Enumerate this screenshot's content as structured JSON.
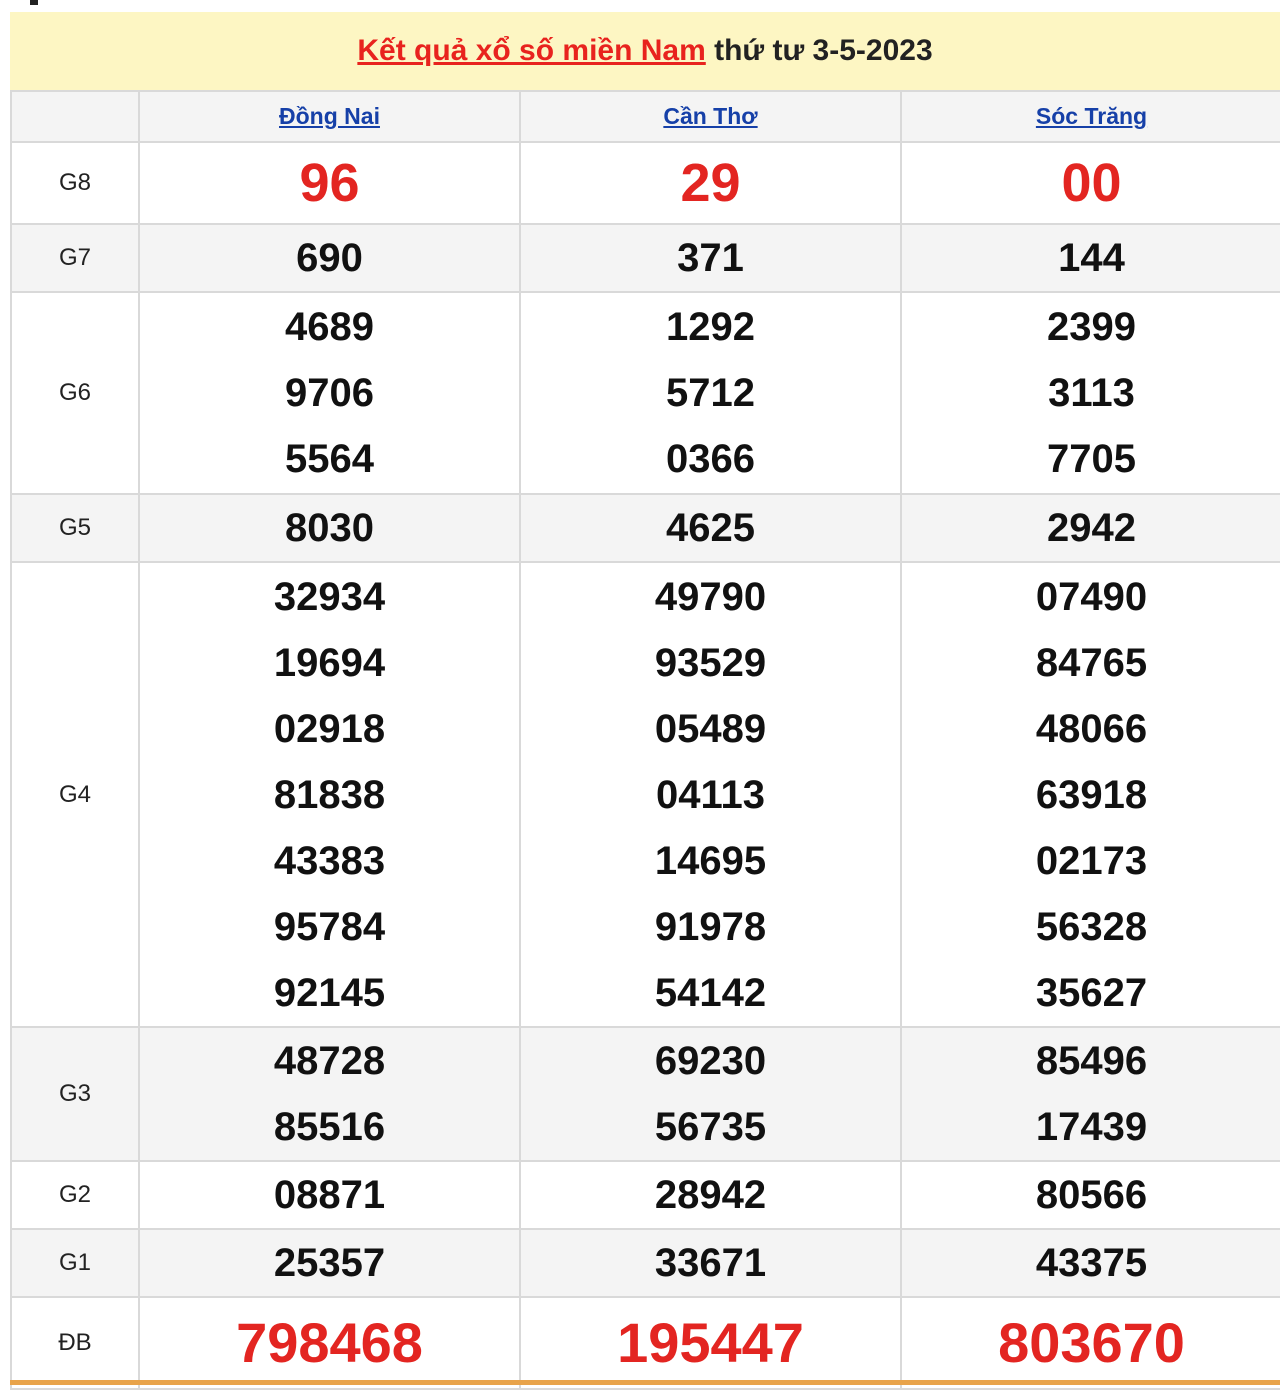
{
  "header": {
    "title_link": "Kết quả xổ số miền Nam",
    "title_rest": " thứ tư 3-5-2023"
  },
  "provinces": [
    "Đồng Nai",
    "Cần Thơ",
    "Sóc Trăng"
  ],
  "prizes": [
    {
      "label": "G8",
      "numbers": [
        [
          "96"
        ],
        [
          "29"
        ],
        [
          "00"
        ]
      ]
    },
    {
      "label": "G7",
      "numbers": [
        [
          "690"
        ],
        [
          "371"
        ],
        [
          "144"
        ]
      ]
    },
    {
      "label": "G6",
      "numbers": [
        [
          "4689",
          "9706",
          "5564"
        ],
        [
          "1292",
          "5712",
          "0366"
        ],
        [
          "2399",
          "3113",
          "7705"
        ]
      ]
    },
    {
      "label": "G5",
      "numbers": [
        [
          "8030"
        ],
        [
          "4625"
        ],
        [
          "2942"
        ]
      ]
    },
    {
      "label": "G4",
      "numbers": [
        [
          "32934",
          "19694",
          "02918",
          "81838",
          "43383",
          "95784",
          "92145"
        ],
        [
          "49790",
          "93529",
          "05489",
          "04113",
          "14695",
          "91978",
          "54142"
        ],
        [
          "07490",
          "84765",
          "48066",
          "63918",
          "02173",
          "56328",
          "35627"
        ]
      ]
    },
    {
      "label": "G3",
      "numbers": [
        [
          "48728",
          "85516"
        ],
        [
          "69230",
          "56735"
        ],
        [
          "85496",
          "17439"
        ]
      ]
    },
    {
      "label": "G2",
      "numbers": [
        [
          "08871"
        ],
        [
          "28942"
        ],
        [
          "80566"
        ]
      ]
    },
    {
      "label": "G1",
      "numbers": [
        [
          "25357"
        ],
        [
          "33671"
        ],
        [
          "43375"
        ]
      ]
    },
    {
      "label": "ĐB",
      "numbers": [
        [
          "798468"
        ],
        [
          "195447"
        ],
        [
          "803670"
        ]
      ]
    }
  ]
}
